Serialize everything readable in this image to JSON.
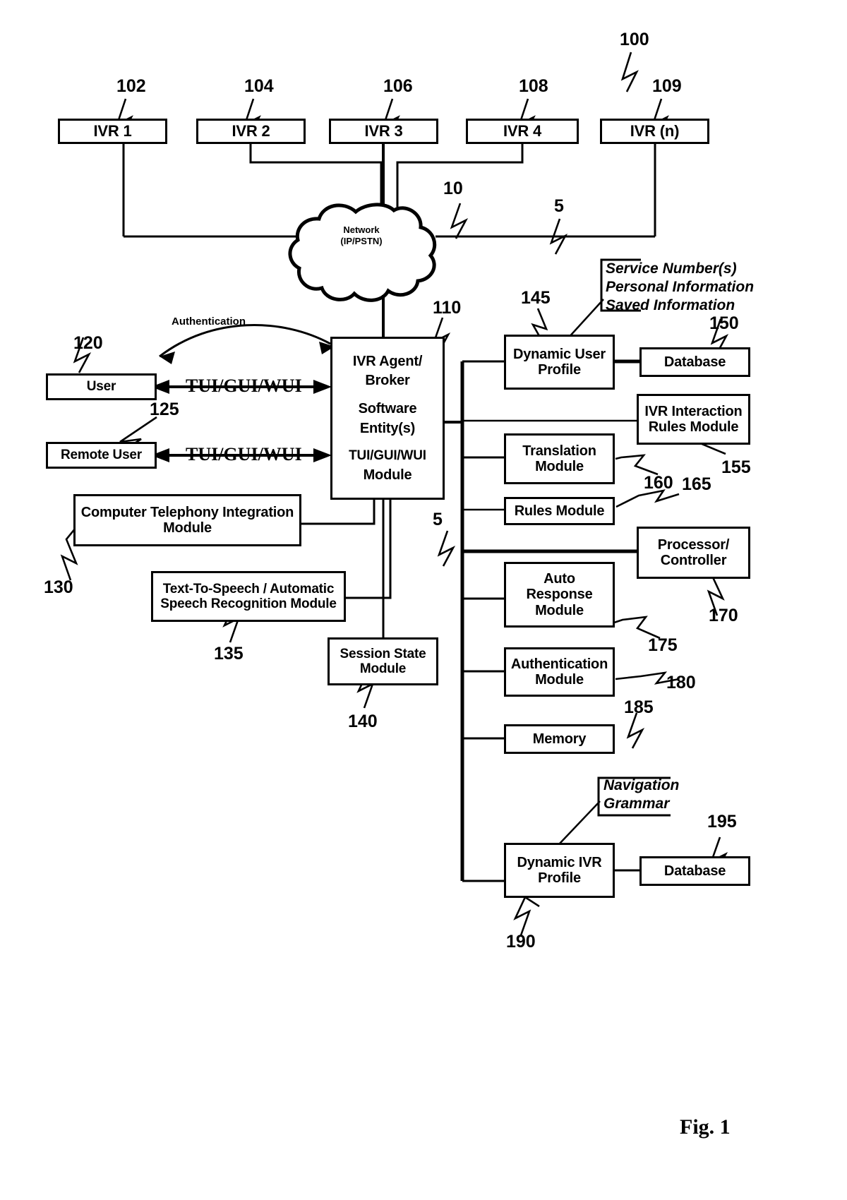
{
  "figure": {
    "caption": "Fig. 1",
    "system_ref": "100"
  },
  "ivr_row": {
    "boxes": [
      {
        "label": "IVR 1",
        "ref": "102"
      },
      {
        "label": "IVR 2",
        "ref": "104"
      },
      {
        "label": "IVR 3",
        "ref": "106"
      },
      {
        "label": "IVR 4",
        "ref": "108"
      },
      {
        "label": "IVR (n)",
        "ref": "109"
      }
    ]
  },
  "network": {
    "line1": "Network",
    "line2": "(IP/PSTN)",
    "ref": "10",
    "link_ref": "5"
  },
  "agent": {
    "line1": "IVR Agent/",
    "line2": "Broker",
    "line3": "Software",
    "line4": "Entity(s)",
    "line5": "TUI/GUI/WUI",
    "line6": "Module",
    "ref": "110"
  },
  "left": {
    "user": {
      "label": "User",
      "ref": "120"
    },
    "remote_user": {
      "label": "Remote User",
      "ref": "125"
    },
    "cti": {
      "line1": "Computer Telephony Integration",
      "line2": "Module",
      "ref": "130"
    },
    "tts_asr": {
      "line1": "Text-To-Speech / Automatic",
      "line2": "Speech Recognition Module",
      "ref": "135"
    },
    "session_state": {
      "line1": "Session State",
      "line2": "Module",
      "ref": "140"
    },
    "authentication_arrow_label": "Authentication",
    "interface_label_user": "TUI/GUI/WUI",
    "interface_label_remote": "TUI/GUI/WUI"
  },
  "bus": {
    "ref": "5"
  },
  "right": {
    "dynamic_user_profile": {
      "line1": "Dynamic  User",
      "line2": "Profile",
      "ref": "145"
    },
    "user_db": {
      "label": "Database",
      "ref": "150"
    },
    "user_profile_annotation": [
      "Service Number(s)",
      "Personal Information",
      "Saved Information"
    ],
    "ivr_interaction_rules": {
      "line1": "IVR Interaction",
      "line2": "Rules Module",
      "ref": "155"
    },
    "translation": {
      "line1": "Translation",
      "line2": "Module",
      "ref": "160"
    },
    "rules": {
      "label": "Rules Module",
      "ref": "165"
    },
    "processor": {
      "line1": "Processor/",
      "line2": "Controller",
      "ref": "170"
    },
    "auto_response": {
      "line1": "Auto",
      "line2": "Response",
      "line3": "Module",
      "ref": "175"
    },
    "auth_module": {
      "line1": "Authentication",
      "line2": "Module",
      "ref": "180"
    },
    "memory": {
      "label": "Memory",
      "ref": "185"
    },
    "dynamic_ivr_profile": {
      "line1": "Dynamic  IVR",
      "line2": "Profile",
      "ref": "190"
    },
    "ivr_db": {
      "label": "Database",
      "ref": "195"
    },
    "ivr_profile_annotation": [
      "Navigation",
      "Grammar"
    ]
  }
}
